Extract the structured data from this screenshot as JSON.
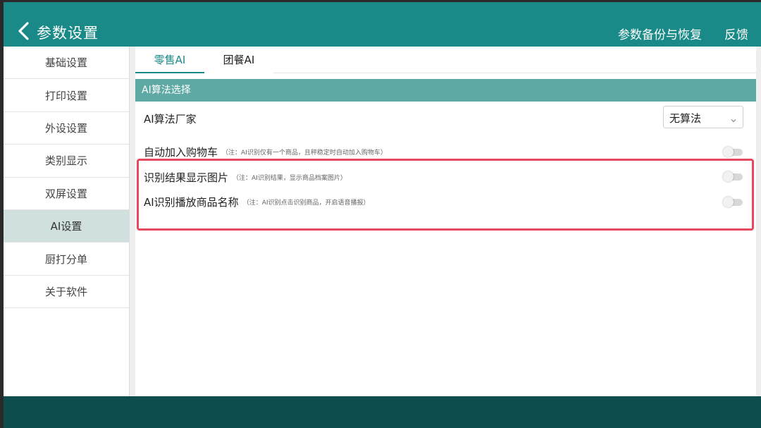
{
  "header": {
    "title": "参数设置",
    "backup_label": "参数备份与恢复",
    "feedback_label": "反馈",
    "color": "#1a8a88"
  },
  "sidebar": {
    "items": [
      {
        "label": "基础设置",
        "active": false
      },
      {
        "label": "打印设置",
        "active": false
      },
      {
        "label": "外设设置",
        "active": false
      },
      {
        "label": "类别显示",
        "active": false
      },
      {
        "label": "双屏设置",
        "active": false
      },
      {
        "label": "AI设置",
        "active": true
      },
      {
        "label": "厨打分单",
        "active": false
      },
      {
        "label": "关于软件",
        "active": false
      }
    ]
  },
  "tabs": [
    {
      "label": "零售AI",
      "active": true
    },
    {
      "label": "团餐AI",
      "active": false
    }
  ],
  "section": {
    "title": "AI算法选择"
  },
  "settings": {
    "vendor": {
      "label": "AI算法厂家",
      "value": "无算法"
    },
    "auto_cart": {
      "label": "自动加入购物车",
      "note": "（注：AI识别仅有一个商品，且秤稳定时自动加入购物车）",
      "on": false
    },
    "show_image": {
      "label": "识别结果显示图片",
      "note": "（注：AI识别结果，显示商品档案图片）",
      "on": false
    },
    "play_name": {
      "label": "AI识别播放商品名称",
      "note": "（注：AI识别点击识别商品，开启语音播报）",
      "on": false
    }
  },
  "colors": {
    "accent": "#1a8a88",
    "section_bar": "#5fa9a5",
    "footer": "#0e4c4e",
    "highlight": "#e8485e"
  }
}
